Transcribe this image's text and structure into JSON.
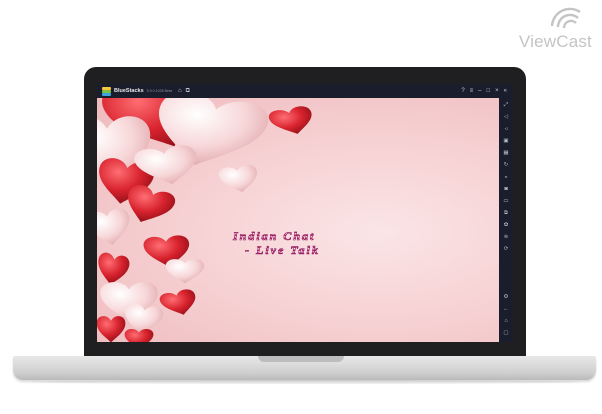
{
  "watermark": {
    "brand": "ViewCast",
    "icon": "signal-waves-icon"
  },
  "window": {
    "app_name": "BlueStacks",
    "version": "5.9.0.1028 Beta",
    "titlebar_left_icons": [
      "home-icon",
      "multi-instance-icon"
    ],
    "titlebar_right_icons": [
      "help-icon",
      "menu-icon",
      "minimize-icon",
      "maximize-icon",
      "close-icon",
      "collapse-sidebar-icon"
    ]
  },
  "game": {
    "title_line1": "Indian Chat",
    "title_line2": "- Live Talk"
  },
  "sidebar": {
    "top_icons": [
      "fullscreen-icon",
      "volume-icon",
      "volume-down-icon",
      "screen-record-icon",
      "keymap-icon",
      "rotate-icon",
      "shake-icon",
      "screenshot-icon",
      "folder-icon",
      "multi-instance-icon",
      "eco-mode-icon",
      "layers-icon",
      "sync-icon"
    ],
    "bottom_icons": [
      "settings-icon",
      "back-icon",
      "home-icon",
      "recent-apps-icon"
    ]
  },
  "colors": {
    "bluestacks_chrome": "#1a1d2b",
    "heart_red": "#d8232e",
    "heart_pink": "#f7d6d8",
    "title_magenta": "#c2287a"
  }
}
